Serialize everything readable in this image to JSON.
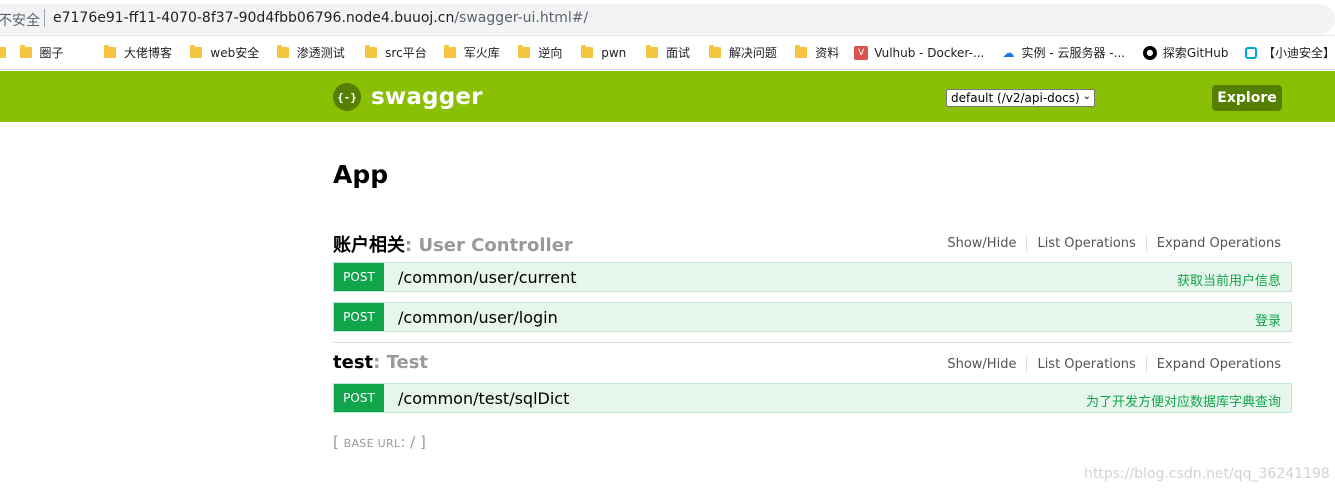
{
  "browser": {
    "insecure_label": "不安全",
    "url_host": "e7176e91-ff11-4070-8f37-90d4fbb06796.node4.buuoj.cn",
    "url_path": "/swagger-ui.html#/"
  },
  "bookmarks": [
    {
      "label": "",
      "icon": "folder-icon"
    },
    {
      "label": "圈子",
      "icon": "folder-icon"
    },
    {
      "label": "大佬博客",
      "icon": "folder-icon"
    },
    {
      "label": "web安全",
      "icon": "folder-icon"
    },
    {
      "label": "渗透测试",
      "icon": "folder-icon"
    },
    {
      "label": "src平台",
      "icon": "folder-icon"
    },
    {
      "label": "军火库",
      "icon": "folder-icon"
    },
    {
      "label": "逆向",
      "icon": "folder-icon"
    },
    {
      "label": "pwn",
      "icon": "folder-icon"
    },
    {
      "label": "面试",
      "icon": "folder-icon"
    },
    {
      "label": "解决问题",
      "icon": "folder-icon"
    },
    {
      "label": "资料",
      "icon": "folder-icon"
    },
    {
      "label": "Vulhub - Docker-...",
      "icon": "vulhub-icon"
    },
    {
      "label": "实例 - 云服务器 -...",
      "icon": "cloud-icon"
    },
    {
      "label": "探索GitHub",
      "icon": "github-icon"
    },
    {
      "label": "【小迪安全】",
      "icon": "bilibili-icon"
    }
  ],
  "header": {
    "logo_icon_glyph": "{-}",
    "logo_text": "swagger",
    "api_select_value": "default (/v2/api-docs)",
    "explore_label": "Explore"
  },
  "main": {
    "title": "App",
    "resource_ops": {
      "show_hide": "Show/Hide",
      "list_ops": "List Operations",
      "expand_ops": "Expand Operations"
    },
    "resources": [
      {
        "name": "账户相关",
        "description": ": User Controller",
        "operations": [
          {
            "method": "POST",
            "path": "/common/user/current",
            "summary": "获取当前用户信息"
          },
          {
            "method": "POST",
            "path": "/common/user/login",
            "summary": "登录"
          }
        ]
      },
      {
        "name": "test",
        "description": ": Test",
        "operations": [
          {
            "method": "POST",
            "path": "/common/test/sqlDict",
            "summary": "为了开发方便对应数据库字典查询"
          }
        ]
      }
    ],
    "base_url": {
      "open": "[ ",
      "label": "BASE URL",
      "value": ": / ]"
    }
  },
  "watermark": "https://blog.csdn.net/qq_36241198",
  "colors": {
    "header_bg": "#89bf04",
    "post_green": "#10a54a",
    "op_bg": "#e7f6ec"
  }
}
